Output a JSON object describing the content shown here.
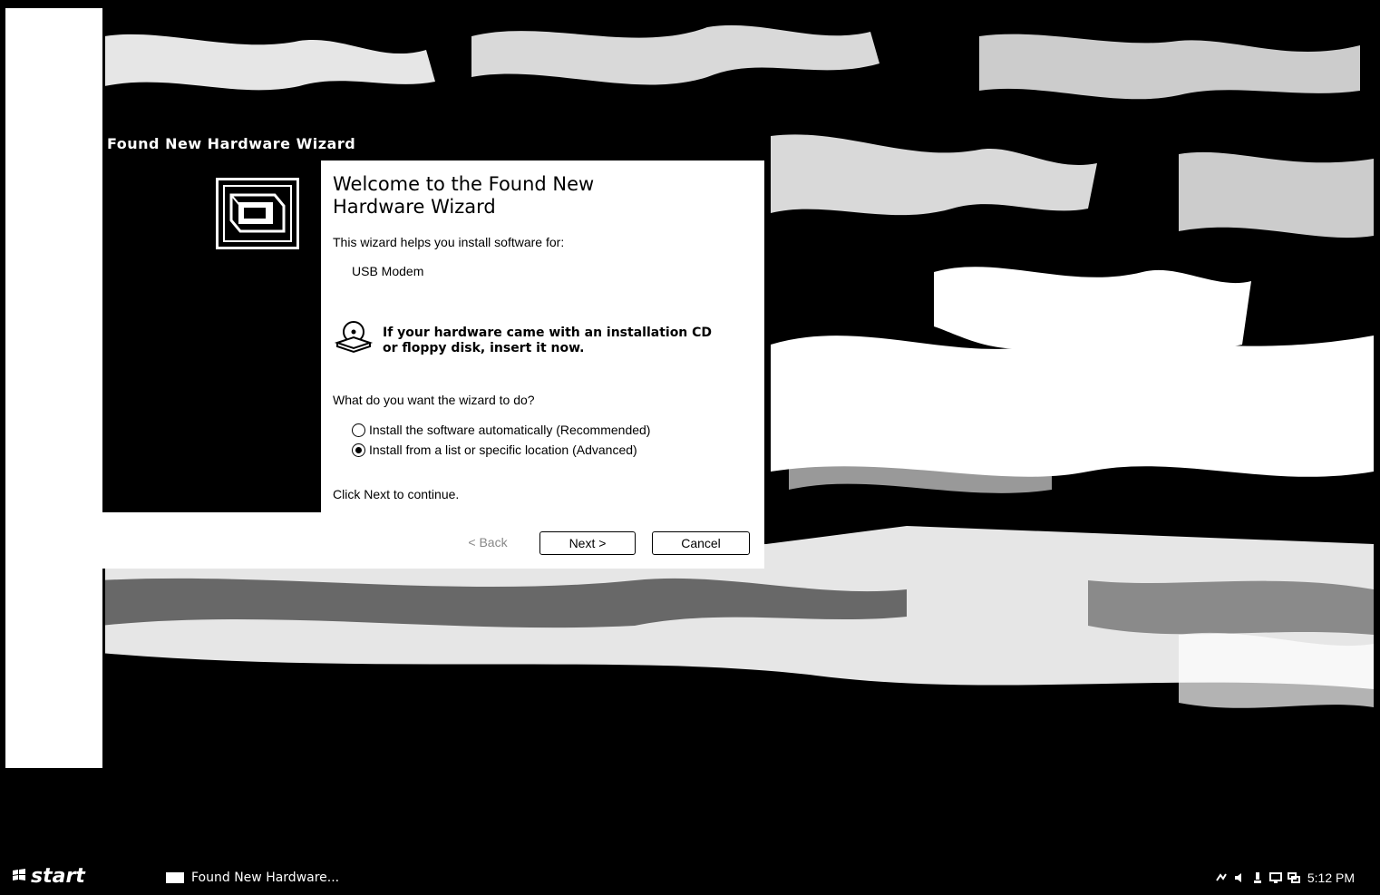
{
  "wizard": {
    "title": "Found New Hardware Wizard",
    "heading_line1": "Welcome to the Found New",
    "heading_line2": "Hardware Wizard",
    "intro": "This wizard helps you install software for:",
    "device": "USB Modem",
    "cd_line1": "If your hardware came with an installation CD",
    "cd_line2": "or floppy disk, insert it now.",
    "question": "What do you want the wizard to do?",
    "options": [
      {
        "label": "Install the software automatically (Recommended)",
        "selected": false
      },
      {
        "label": "Install from a list or specific location (Advanced)",
        "selected": true
      }
    ],
    "continue_text": "Click Next to continue.",
    "buttons": {
      "back": "< Back",
      "next": "Next >",
      "cancel": "Cancel"
    }
  },
  "taskbar": {
    "start_label": "start",
    "task_label": "Found New Hardware...",
    "clock": "5:12 PM",
    "tray_icons": [
      "network-icon",
      "volume-icon",
      "safely-remove-icon",
      "monitor-icon",
      "connection-icon"
    ]
  }
}
